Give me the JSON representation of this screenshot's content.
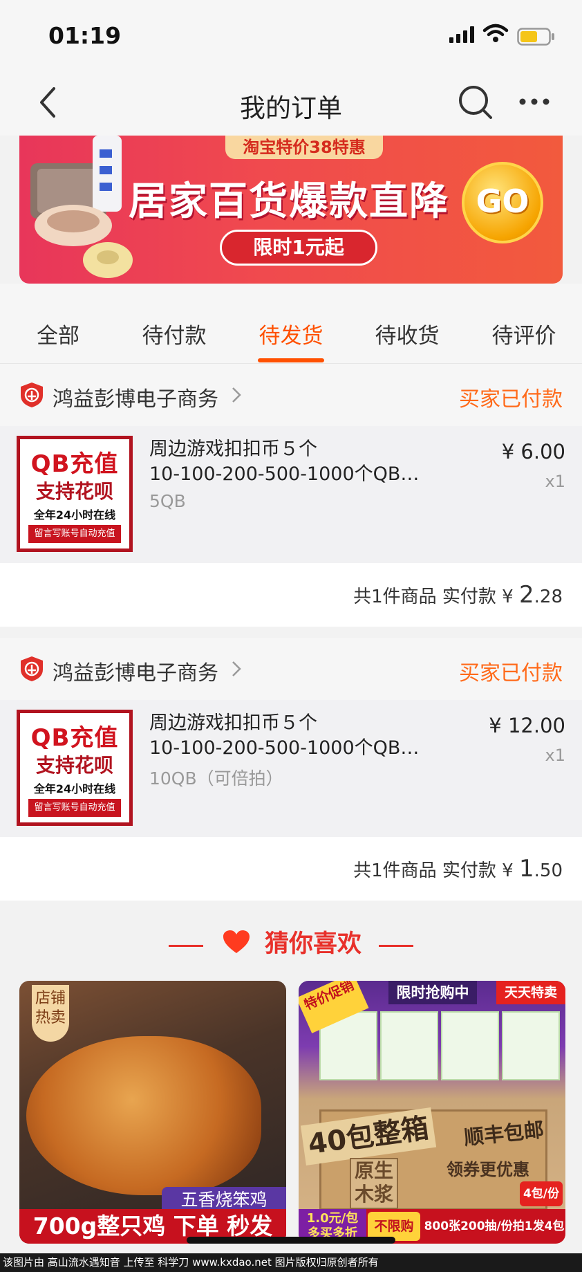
{
  "status_bar": {
    "time": "01:19"
  },
  "nav": {
    "title": "我的订单"
  },
  "banner": {
    "tag": "淘宝特价38特惠",
    "headline": "居家百货爆款直降",
    "pill": "限时1元起",
    "go": "GO"
  },
  "tabs": [
    {
      "label": "全部"
    },
    {
      "label": "待付款"
    },
    {
      "label": "待发货",
      "active": true
    },
    {
      "label": "待收货"
    },
    {
      "label": "待评价"
    }
  ],
  "orders": [
    {
      "shop": "鸿益彭博电子商务",
      "status": "买家已付款",
      "thumb": {
        "line1": "QB充值",
        "line2": "支持花呗",
        "line3": "全年24小时在线",
        "line4": "留言写账号自动充值"
      },
      "title_line1": "周边游戏扣扣币５个",
      "title_line2": "10-100-200-500-1000个QB…",
      "sku": "5QB",
      "price": "¥ 6.00",
      "qty": "x1",
      "summary_prefix": "共1件商品  实付款 ¥ ",
      "paid_int": "2",
      "paid_dec": ".28"
    },
    {
      "shop": "鸿益彭博电子商务",
      "status": "买家已付款",
      "thumb": {
        "line1": "QB充值",
        "line2": "支持花呗",
        "line3": "全年24小时在线",
        "line4": "留言写账号自动充值"
      },
      "title_line1": "周边游戏扣扣币５个",
      "title_line2": "10-100-200-500-1000个QB…",
      "sku": "10QB（可倍拍）",
      "price": "¥ 12.00",
      "qty": "x1",
      "summary_prefix": "共1件商品  实付款 ¥ ",
      "paid_int": "1",
      "paid_dec": ".50"
    }
  ],
  "recommend": {
    "title": "猜你喜欢",
    "product1": {
      "corner": "店铺热卖",
      "sub": "五香烧笨鸡",
      "strip": "700g整只鸡 下单 秒发"
    },
    "product2": {
      "badge": "特价促销",
      "flash": "限时抢购中",
      "brand": "天天特卖",
      "big": "40包整箱",
      "free": "顺丰包邮",
      "pulp": "原生木浆",
      "coupon": "领券更优惠",
      "left": "1.0元/包 多买多折",
      "unlimited": "不限购",
      "spec": "800张200抽/份拍1发4包",
      "count": "4包/份"
    }
  },
  "footer": "该图片由 高山流水遇知音 上传至 科学刀 www.kxdao.net 图片版权归原创者所有",
  "colors": {
    "accent": "#ff5000",
    "status": "#ff6a1a",
    "recommend": "#e8302a"
  }
}
